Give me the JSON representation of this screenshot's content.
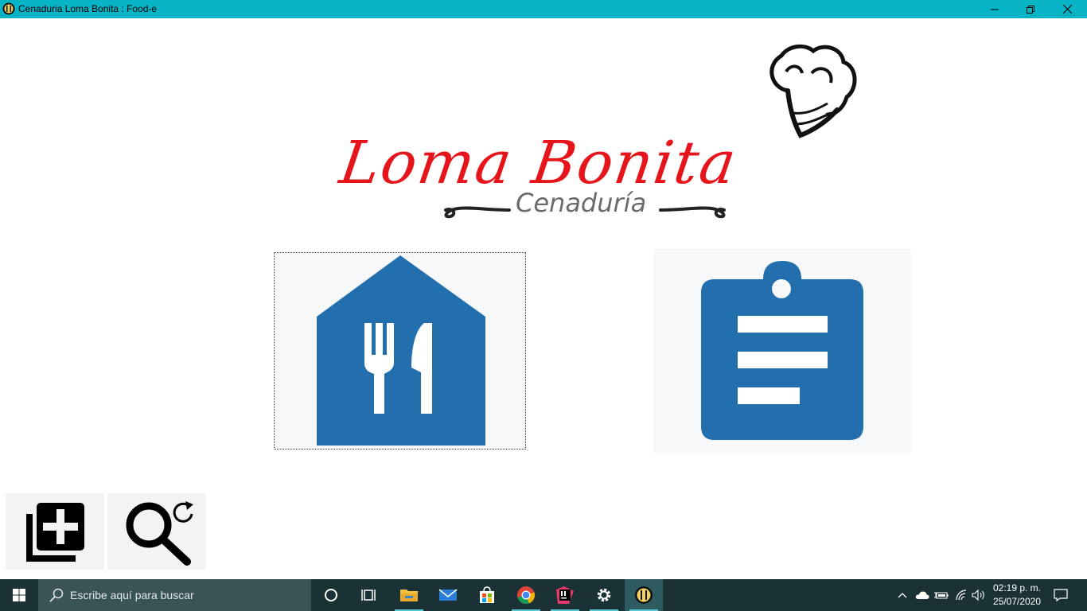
{
  "window": {
    "title": "Cenaduria Loma Bonita : Food-e",
    "controls": [
      "minimize",
      "restore",
      "close"
    ],
    "titlebar_color": "#06b4c6"
  },
  "logo": {
    "main_text": "Loma Bonita",
    "sub_text": "Cenaduría",
    "main_color": "#e6151c",
    "sub_color": "#6b6b6b",
    "icon": "chef-hat-icon"
  },
  "tiles": [
    {
      "icon": "restaurant-house-icon",
      "color": "#236ead",
      "focused": true
    },
    {
      "icon": "clipboard-list-icon",
      "color": "#236ead",
      "focused": false
    }
  ],
  "bottom_buttons": [
    {
      "icon": "add-item-icon"
    },
    {
      "icon": "search-refresh-icon"
    }
  ],
  "taskbar": {
    "search_placeholder": "Escribe aquí para buscar",
    "apps": [
      "cortana-icon",
      "task-view-icon",
      "file-explorer-icon",
      "mail-icon",
      "store-icon",
      "chrome-icon",
      "intellij-icon",
      "settings-icon",
      "food-e-app-icon"
    ],
    "tray": [
      "chevron-up-icon",
      "onedrive-icon",
      "battery-icon",
      "wifi-icon",
      "volume-icon"
    ],
    "time": "02:19 p. m.",
    "date": "25/07/2020",
    "notification_icon": "action-center-icon"
  }
}
